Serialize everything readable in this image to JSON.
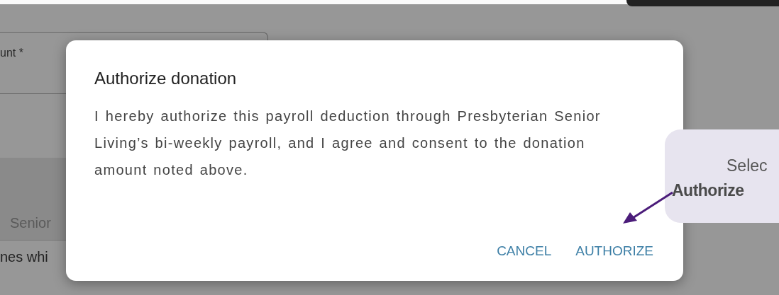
{
  "background_form": {
    "field_label": "unt *",
    "band_text": "Senior",
    "line_text": "nes whi"
  },
  "dialog": {
    "title": "Authorize donation",
    "body": "I hereby authorize this payroll deduction through Presbyterian Senior Living’s bi-weekly payroll, and I agree and consent to the donation amount noted above.",
    "buttons": [
      {
        "label": "CANCEL"
      },
      {
        "label": "AUTHORIZE"
      }
    ]
  },
  "callout": {
    "line_1": "Selec",
    "line_2": "Authorize"
  }
}
